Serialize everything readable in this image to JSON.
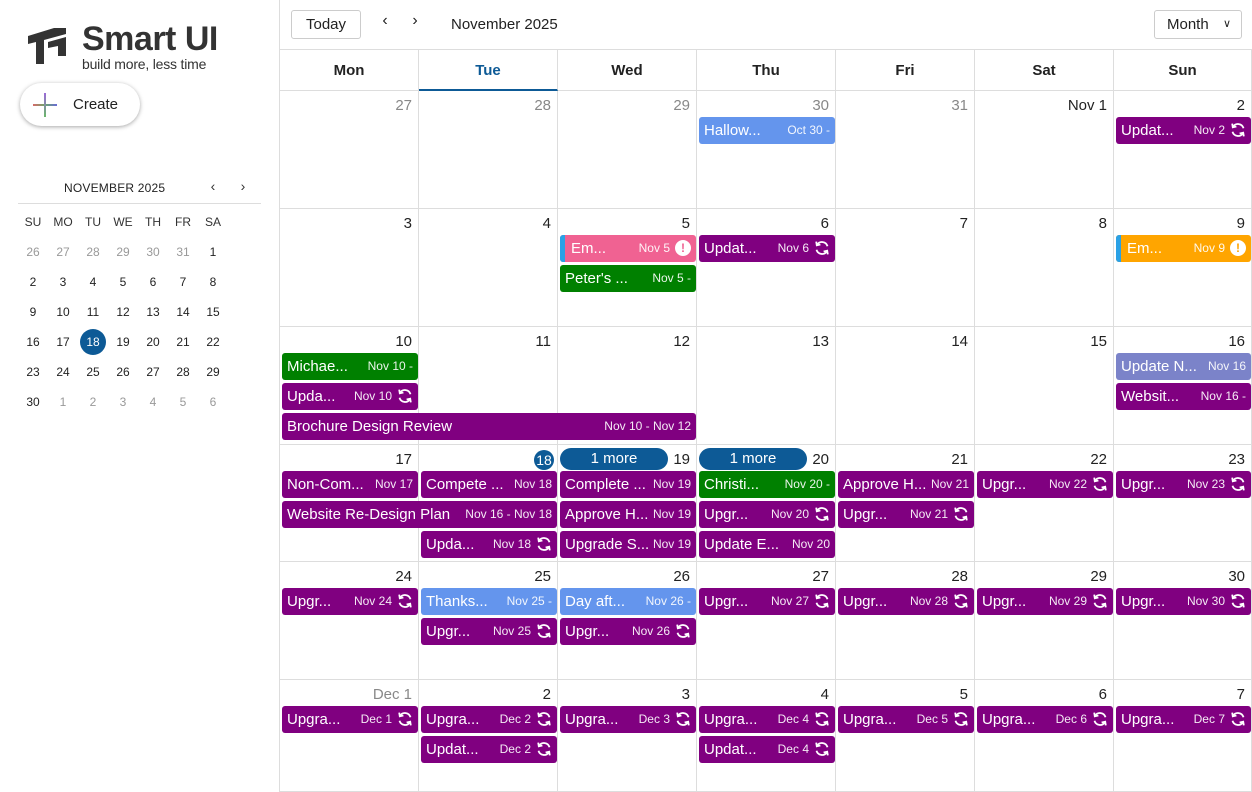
{
  "brand": {
    "name": "Smart UI",
    "tagline": "build more, less time"
  },
  "create_label": "Create",
  "mini_calendar": {
    "title": "NOVEMBER 2025",
    "weekdays": [
      "SU",
      "MO",
      "TU",
      "WE",
      "TH",
      "FR",
      "SA"
    ],
    "weeks": [
      [
        "26",
        "27",
        "28",
        "29",
        "30",
        "31",
        "1"
      ],
      [
        "2",
        "3",
        "4",
        "5",
        "6",
        "7",
        "8"
      ],
      [
        "9",
        "10",
        "11",
        "12",
        "13",
        "14",
        "15"
      ],
      [
        "16",
        "17",
        "18",
        "19",
        "20",
        "21",
        "22"
      ],
      [
        "23",
        "24",
        "25",
        "26",
        "27",
        "28",
        "29"
      ],
      [
        "30",
        "1",
        "2",
        "3",
        "4",
        "5",
        "6"
      ]
    ],
    "selected": "18"
  },
  "toolbar": {
    "today_label": "Today",
    "range_label": "November 2025",
    "view_label": "Month",
    "prev_icon": "‹",
    "next_icon": "›"
  },
  "weekdays": [
    "Mon",
    "Tue",
    "Wed",
    "Thu",
    "Fri",
    "Sat",
    "Sun"
  ],
  "active_weekday": "Tue",
  "weeks": [
    [
      "27",
      "28",
      "29",
      "30",
      "31",
      "Nov 1",
      "2"
    ],
    [
      "3",
      "4",
      "5",
      "6",
      "7",
      "8",
      "9"
    ],
    [
      "10",
      "11",
      "12",
      "13",
      "14",
      "15",
      "16"
    ],
    [
      "17",
      "18",
      "19",
      "20",
      "21",
      "22",
      "23"
    ],
    [
      "24",
      "25",
      "26",
      "27",
      "28",
      "29",
      "30"
    ],
    [
      "Dec 1",
      "2",
      "3",
      "4",
      "5",
      "6",
      "7"
    ]
  ],
  "other_month_days": [
    "27",
    "28",
    "29",
    "30",
    "31",
    "Dec 1"
  ],
  "today_label": "18",
  "colors": {
    "purple": "#800080",
    "green": "#008000",
    "light_blue": "#6495ed",
    "pink": "#f06292",
    "orange": "#ffa500",
    "slate": "#7b83c9",
    "today": "#0d5a96"
  },
  "more_labels": [
    {
      "text": "1 more",
      "week": 3,
      "col": 2
    },
    {
      "text": "1 more",
      "week": 3,
      "col": 3
    }
  ],
  "events": [
    {
      "title": "Hallow...",
      "date": "Oct 30 -",
      "week": 0,
      "col": 3,
      "span": 1,
      "row": 0,
      "color": "light_blue",
      "icon": ""
    },
    {
      "title": "Updat...",
      "date": "Nov 2",
      "week": 0,
      "col": 6,
      "span": 1,
      "row": 0,
      "color": "purple",
      "icon": "recurring-icon"
    },
    {
      "title": "Em...",
      "date": "Nov 5",
      "week": 1,
      "col": 2,
      "span": 1,
      "row": 0,
      "color": "pink",
      "icon": "alert-icon",
      "bar": true
    },
    {
      "title": "Peter's ...",
      "date": "Nov 5 -",
      "week": 1,
      "col": 2,
      "span": 1,
      "row": 1,
      "color": "green",
      "icon": ""
    },
    {
      "title": "Updat...",
      "date": "Nov 6",
      "week": 1,
      "col": 3,
      "span": 1,
      "row": 0,
      "color": "purple",
      "icon": "recurring-icon"
    },
    {
      "title": "Em...",
      "date": "Nov 9",
      "week": 1,
      "col": 6,
      "span": 1,
      "row": 0,
      "color": "orange",
      "icon": "alert-icon",
      "bar": true
    },
    {
      "title": "Michae...",
      "date": "Nov 10 -",
      "week": 2,
      "col": 0,
      "span": 1,
      "row": 0,
      "color": "green",
      "icon": ""
    },
    {
      "title": "Upda...",
      "date": "Nov 10",
      "week": 2,
      "col": 0,
      "span": 1,
      "row": 1,
      "color": "purple",
      "icon": "recurring-icon"
    },
    {
      "title": "Brochure Design Review",
      "date": "Nov 10 - Nov 12",
      "week": 2,
      "col": 0,
      "span": 3,
      "row": 2,
      "color": "purple",
      "icon": ""
    },
    {
      "title": "Update N...",
      "date": "Nov 16",
      "week": 2,
      "col": 6,
      "span": 1,
      "row": 0,
      "color": "slate",
      "icon": ""
    },
    {
      "title": "Websit...",
      "date": "Nov 16 -",
      "week": 2,
      "col": 6,
      "span": 1,
      "row": 1,
      "color": "purple",
      "icon": ""
    },
    {
      "title": "Non-Com...",
      "date": "Nov 17",
      "week": 3,
      "col": 0,
      "span": 1,
      "row": 0,
      "color": "purple",
      "icon": ""
    },
    {
      "title": "Compete ...",
      "date": "Nov 18",
      "week": 3,
      "col": 1,
      "span": 1,
      "row": 0,
      "color": "purple",
      "icon": ""
    },
    {
      "title": "Complete ...",
      "date": "Nov 19",
      "week": 3,
      "col": 2,
      "span": 1,
      "row": 0,
      "color": "purple",
      "icon": ""
    },
    {
      "title": "Christi...",
      "date": "Nov 20 -",
      "week": 3,
      "col": 3,
      "span": 1,
      "row": 0,
      "color": "green",
      "icon": ""
    },
    {
      "title": "Approve H...",
      "date": "Nov 21",
      "week": 3,
      "col": 4,
      "span": 1,
      "row": 0,
      "color": "purple",
      "icon": ""
    },
    {
      "title": "Upgr...",
      "date": "Nov 22",
      "week": 3,
      "col": 5,
      "span": 1,
      "row": 0,
      "color": "purple",
      "icon": "recurring-icon"
    },
    {
      "title": "Upgr...",
      "date": "Nov 23",
      "week": 3,
      "col": 6,
      "span": 1,
      "row": 0,
      "color": "purple",
      "icon": "recurring-icon"
    },
    {
      "title": "Website Re-Design Plan",
      "date": "Nov 16 - Nov 18",
      "week": 3,
      "col": 0,
      "span": 2,
      "row": 1,
      "color": "purple",
      "icon": ""
    },
    {
      "title": "Approve H...",
      "date": "Nov 19",
      "week": 3,
      "col": 2,
      "span": 1,
      "row": 1,
      "color": "purple",
      "icon": ""
    },
    {
      "title": "Upgr...",
      "date": "Nov 20",
      "week": 3,
      "col": 3,
      "span": 1,
      "row": 1,
      "color": "purple",
      "icon": "recurring-icon"
    },
    {
      "title": "Upgr...",
      "date": "Nov 21",
      "week": 3,
      "col": 4,
      "span": 1,
      "row": 1,
      "color": "purple",
      "icon": "recurring-icon"
    },
    {
      "title": "Upda...",
      "date": "Nov 18",
      "week": 3,
      "col": 1,
      "span": 1,
      "row": 2,
      "color": "purple",
      "icon": "recurring-icon"
    },
    {
      "title": "Upgrade S...",
      "date": "Nov 19",
      "week": 3,
      "col": 2,
      "span": 1,
      "row": 2,
      "color": "purple",
      "icon": ""
    },
    {
      "title": "Update E...",
      "date": "Nov 20",
      "week": 3,
      "col": 3,
      "span": 1,
      "row": 2,
      "color": "purple",
      "icon": ""
    },
    {
      "title": "Upgr...",
      "date": "Nov 24",
      "week": 4,
      "col": 0,
      "span": 1,
      "row": 0,
      "color": "purple",
      "icon": "recurring-icon"
    },
    {
      "title": "Thanks...",
      "date": "Nov 25 -",
      "week": 4,
      "col": 1,
      "span": 1,
      "row": 0,
      "color": "light_blue",
      "icon": ""
    },
    {
      "title": "Day aft...",
      "date": "Nov 26 -",
      "week": 4,
      "col": 2,
      "span": 1,
      "row": 0,
      "color": "light_blue",
      "icon": ""
    },
    {
      "title": "Upgr...",
      "date": "Nov 27",
      "week": 4,
      "col": 3,
      "span": 1,
      "row": 0,
      "color": "purple",
      "icon": "recurring-icon"
    },
    {
      "title": "Upgr...",
      "date": "Nov 28",
      "week": 4,
      "col": 4,
      "span": 1,
      "row": 0,
      "color": "purple",
      "icon": "recurring-icon"
    },
    {
      "title": "Upgr...",
      "date": "Nov 29",
      "week": 4,
      "col": 5,
      "span": 1,
      "row": 0,
      "color": "purple",
      "icon": "recurring-icon"
    },
    {
      "title": "Upgr...",
      "date": "Nov 30",
      "week": 4,
      "col": 6,
      "span": 1,
      "row": 0,
      "color": "purple",
      "icon": "recurring-icon"
    },
    {
      "title": "Upgr...",
      "date": "Nov 25",
      "week": 4,
      "col": 1,
      "span": 1,
      "row": 1,
      "color": "purple",
      "icon": "recurring-icon"
    },
    {
      "title": "Upgr...",
      "date": "Nov 26",
      "week": 4,
      "col": 2,
      "span": 1,
      "row": 1,
      "color": "purple",
      "icon": "recurring-icon"
    },
    {
      "title": "Upgra...",
      "date": "Dec 1",
      "week": 5,
      "col": 0,
      "span": 1,
      "row": 0,
      "color": "purple",
      "icon": "recurring-icon"
    },
    {
      "title": "Upgra...",
      "date": "Dec 2",
      "week": 5,
      "col": 1,
      "span": 1,
      "row": 0,
      "color": "purple",
      "icon": "recurring-icon"
    },
    {
      "title": "Upgra...",
      "date": "Dec 3",
      "week": 5,
      "col": 2,
      "span": 1,
      "row": 0,
      "color": "purple",
      "icon": "recurring-icon"
    },
    {
      "title": "Upgra...",
      "date": "Dec 4",
      "week": 5,
      "col": 3,
      "span": 1,
      "row": 0,
      "color": "purple",
      "icon": "recurring-icon"
    },
    {
      "title": "Upgra...",
      "date": "Dec 5",
      "week": 5,
      "col": 4,
      "span": 1,
      "row": 0,
      "color": "purple",
      "icon": "recurring-icon"
    },
    {
      "title": "Upgra...",
      "date": "Dec 6",
      "week": 5,
      "col": 5,
      "span": 1,
      "row": 0,
      "color": "purple",
      "icon": "recurring-icon"
    },
    {
      "title": "Upgra...",
      "date": "Dec 7",
      "week": 5,
      "col": 6,
      "span": 1,
      "row": 0,
      "color": "purple",
      "icon": "recurring-icon"
    },
    {
      "title": "Updat...",
      "date": "Dec 2",
      "week": 5,
      "col": 1,
      "span": 1,
      "row": 1,
      "color": "purple",
      "icon": "recurring-icon"
    },
    {
      "title": "Updat...",
      "date": "Dec 4",
      "week": 5,
      "col": 3,
      "span": 1,
      "row": 1,
      "color": "purple",
      "icon": "recurring-icon"
    }
  ]
}
